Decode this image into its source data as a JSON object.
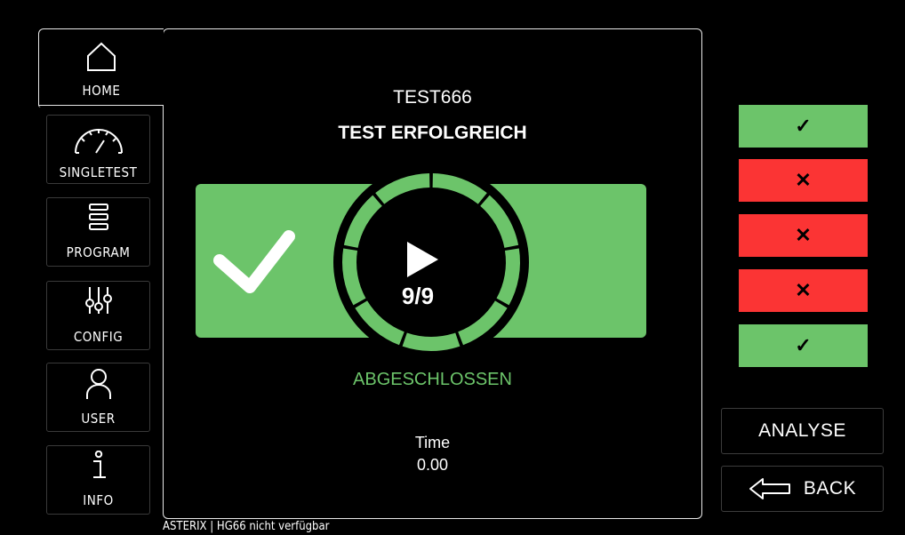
{
  "nav": {
    "home": "HOME",
    "singletest": "SINGLETEST",
    "program": "PROGRAM",
    "config": "CONFIG",
    "user": "USER",
    "info": "INFO"
  },
  "main": {
    "program_name": "TEST666",
    "result_title": "TEST ERFOLGREICH",
    "progress_text": "9/9",
    "progress_done": 9,
    "progress_total": 9,
    "status_text": "ABGESCHLOSSEN",
    "time_label": "Time",
    "time_value": "0.00"
  },
  "results": [
    {
      "status": "pass",
      "symbol": "✓"
    },
    {
      "status": "fail",
      "symbol": "✕"
    },
    {
      "status": "fail",
      "symbol": "✕"
    },
    {
      "status": "fail",
      "symbol": "✕"
    },
    {
      "status": "pass",
      "symbol": "✓"
    }
  ],
  "actions": {
    "analyse": "ANALYSE",
    "back": "BACK"
  },
  "footer": {
    "status": "ASTERIX | HG66 nicht verfügbar"
  },
  "colors": {
    "pass": "#6cc46a",
    "fail": "#fb3434",
    "background": "#000000"
  }
}
